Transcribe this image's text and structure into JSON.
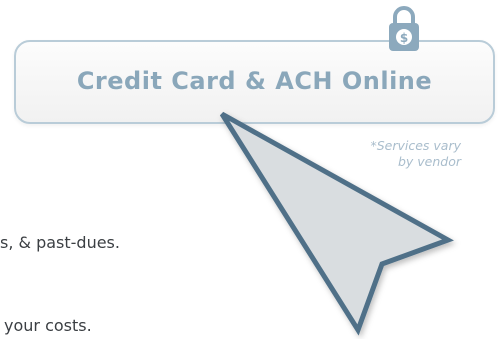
{
  "button": {
    "label": "Credit Card & ACH Online",
    "icon": "padlock-dollar-icon"
  },
  "note": {
    "line1": "*Services vary",
    "line2": "by vendor"
  },
  "body_text": {
    "line1": "s, & past-dues.",
    "line2": "your costs."
  },
  "colors": {
    "border": "#b9ccd8",
    "label": "#8aa7ba",
    "lock": "#8ca9bd",
    "cursor_fill": "#d9dde0",
    "cursor_stroke": "#4f7088"
  },
  "cursor_icon": "arrow-cursor-icon"
}
